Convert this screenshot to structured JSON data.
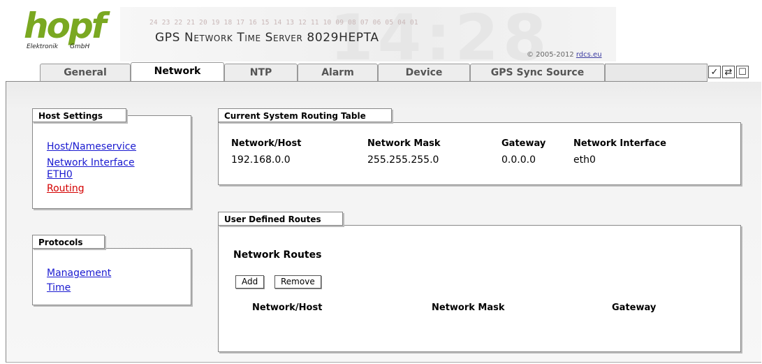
{
  "header": {
    "logo_text": "hopf",
    "logo_sub_left": "Elektronik",
    "logo_sub_right": "GmbH",
    "digit_scale": "24 23 22 21 20 19 18 17 16 15 14 13 12 11 10 09 08 07 06 05 04 01",
    "clock_watermark": "14:28",
    "product_title": "GPS Network Time Server 8029HEPTA",
    "copyright_prefix": "© 2005-2012",
    "copyright_link": "rdcs.eu"
  },
  "tabs": [
    {
      "label": "General"
    },
    {
      "label": "Network"
    },
    {
      "label": "NTP"
    },
    {
      "label": "Alarm"
    },
    {
      "label": "Device"
    },
    {
      "label": "GPS Sync Source"
    }
  ],
  "tab_icons": [
    {
      "name": "checkmark-icon",
      "glyph": "✓"
    },
    {
      "name": "refresh-icon",
      "glyph": "⇄"
    },
    {
      "name": "window-icon",
      "glyph": "☐"
    }
  ],
  "host_settings": {
    "title": "Host Settings",
    "links": [
      "Host/Nameservice",
      "Network Interface",
      "ETH0",
      "Routing"
    ]
  },
  "protocols": {
    "title": "Protocols",
    "links": [
      "Management",
      "Time"
    ]
  },
  "routing_table": {
    "title": "Current System Routing Table",
    "columns": [
      "Network/Host",
      "Network Mask",
      "Gateway",
      "Network Interface"
    ],
    "rows": [
      [
        "192.168.0.0",
        "255.255.255.0",
        "0.0.0.0",
        "eth0"
      ]
    ]
  },
  "user_routes": {
    "title": "User Defined Routes",
    "heading": "Network Routes",
    "add_label": "Add",
    "remove_label": "Remove",
    "columns": [
      "Network/Host",
      "Network Mask",
      "Gateway"
    ]
  },
  "colors": {
    "logo_green": "#7aa821",
    "link_blue": "#1a1ad0",
    "link_active_red": "#d40000"
  }
}
